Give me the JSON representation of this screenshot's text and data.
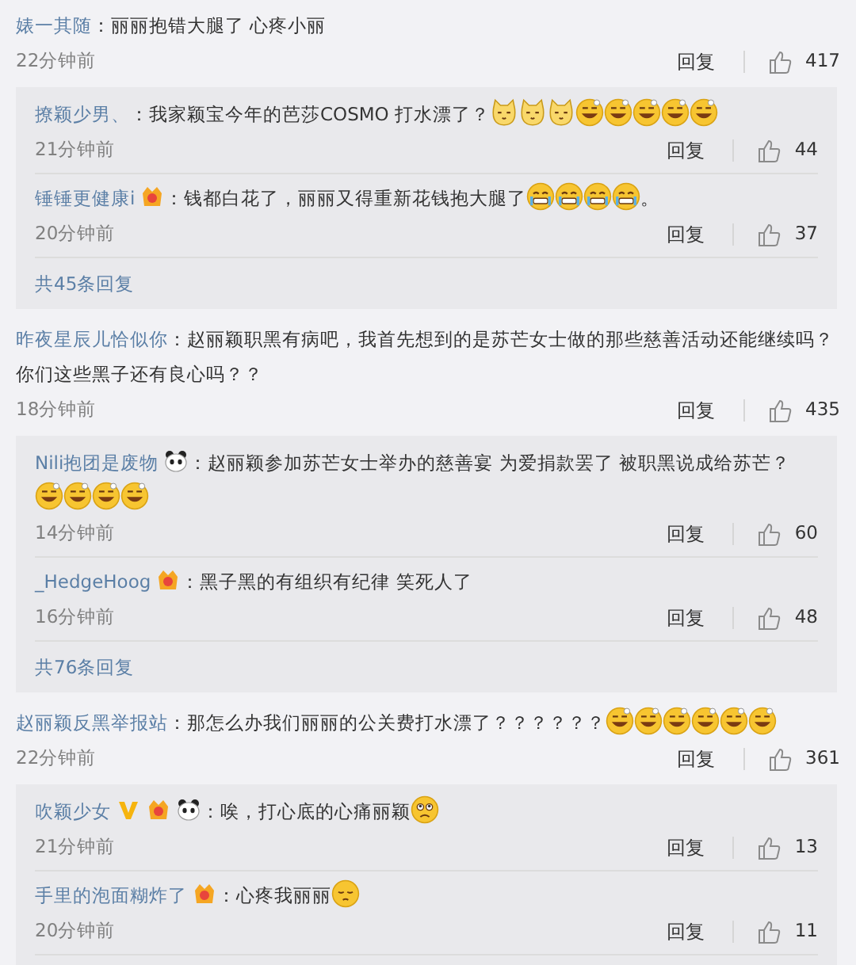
{
  "comments": [
    {
      "user": "婊一其随",
      "content": [
        {
          "kind": "text",
          "text": "：丽丽抱错大腿了 心疼小丽"
        }
      ],
      "time": "22分钟前",
      "reply_label": "回复",
      "likes": "417",
      "replies": [
        {
          "user": "撩颖少男、",
          "content": [
            {
              "kind": "text",
              "text": "：我家颖宝今年的芭莎COSMO 打水漂了？"
            },
            {
              "kind": "cat"
            },
            {
              "kind": "cat"
            },
            {
              "kind": "cat"
            },
            {
              "kind": "grin"
            },
            {
              "kind": "grin"
            },
            {
              "kind": "grin"
            },
            {
              "kind": "grin"
            },
            {
              "kind": "grin"
            }
          ],
          "time": "21分钟前",
          "reply_label": "回复",
          "likes": "44"
        },
        {
          "user": "锤锤更健康i",
          "badges": [
            {
              "kind": "medal"
            }
          ],
          "content": [
            {
              "kind": "text",
              "text": "：钱都白花了，丽丽又得重新花钱抱大腿了"
            },
            {
              "kind": "teary"
            },
            {
              "kind": "teary"
            },
            {
              "kind": "teary"
            },
            {
              "kind": "teary"
            },
            {
              "kind": "text",
              "text": "。"
            }
          ],
          "time": "20分钟前",
          "reply_label": "回复",
          "likes": "37"
        }
      ],
      "more": "共45条回复"
    },
    {
      "user": "昨夜星辰儿恰似你",
      "content": [
        {
          "kind": "text",
          "text": "：赵丽颖职黑有病吧，我首先想到的是苏芒女士做的那些慈善活动还能继续吗？"
        },
        {
          "kind": "line",
          "text": "你们这些黑子还有良心吗？？"
        }
      ],
      "time": "18分钟前",
      "reply_label": "回复",
      "likes": "435",
      "replies": [
        {
          "user": "Nili抱团是废物",
          "badges": [
            {
              "kind": "panda"
            }
          ],
          "content": [
            {
              "kind": "text",
              "text": "：赵丽颖参加苏芒女士举办的慈善宴 为爱捐款罢了 被职黑说成给苏芒？"
            },
            {
              "kind": "grin"
            },
            {
              "kind": "grin"
            },
            {
              "kind": "grin"
            },
            {
              "kind": "grin"
            }
          ],
          "time": "14分钟前",
          "reply_label": "回复",
          "likes": "60"
        },
        {
          "user": "_HedgeHoog",
          "badges": [
            {
              "kind": "medal"
            }
          ],
          "content": [
            {
              "kind": "text",
              "text": "：黑子黑的有组织有纪律 笑死人了"
            }
          ],
          "time": "16分钟前",
          "reply_label": "回复",
          "likes": "48"
        }
      ],
      "more": "共76条回复"
    },
    {
      "user": "赵丽颖反黑举报站",
      "content": [
        {
          "kind": "text",
          "text": "：那怎么办我们丽丽的公关费打水漂了？？？？？？"
        },
        {
          "kind": "grin"
        },
        {
          "kind": "grin"
        },
        {
          "kind": "grin"
        },
        {
          "kind": "grin"
        },
        {
          "kind": "grin"
        },
        {
          "kind": "grin"
        }
      ],
      "time": "22分钟前",
      "reply_label": "回复",
      "likes": "361",
      "replies": [
        {
          "user": "吹颖少女",
          "badges": [
            {
              "kind": "vip"
            },
            {
              "kind": "medal"
            },
            {
              "kind": "panda"
            }
          ],
          "content": [
            {
              "kind": "text",
              "text": "：唉，打心底的心痛丽颖"
            },
            {
              "kind": "frown"
            }
          ],
          "time": "21分钟前",
          "reply_label": "回复",
          "likes": "13"
        },
        {
          "user": "手里的泡面糊炸了",
          "badges": [
            {
              "kind": "medal"
            }
          ],
          "content": [
            {
              "kind": "text",
              "text": "：心疼我丽丽"
            },
            {
              "kind": "sad"
            }
          ],
          "time": "20分钟前",
          "reply_label": "回复",
          "likes": "11"
        }
      ]
    }
  ]
}
